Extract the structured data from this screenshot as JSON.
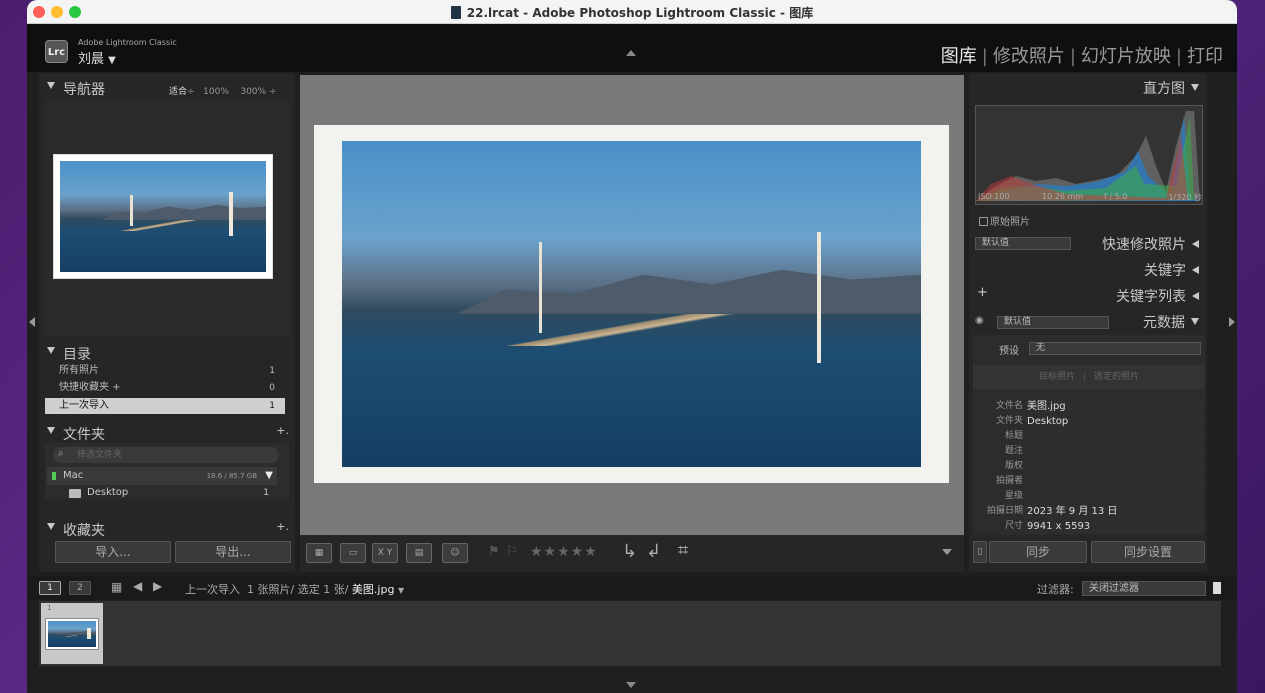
{
  "window": {
    "title": "22.lrcat - Adobe Photoshop Lightroom Classic - 图库"
  },
  "identity": {
    "app": "Adobe Lightroom Classic",
    "user": "刘晨",
    "dropdown": "▼",
    "logo": "Lrc"
  },
  "modules": {
    "library": "图库",
    "develop": "修改照片",
    "slideshow": "幻灯片放映",
    "print": "打印",
    "sep": "|"
  },
  "navigator": {
    "title": "导航器",
    "fit": "适合",
    "zoom1": "100%",
    "zoom2": "300%",
    "spinner": "÷"
  },
  "catalog": {
    "title": "目录",
    "items": [
      {
        "label": "所有照片",
        "count": "1"
      },
      {
        "label": "快捷收藏夹 +",
        "count": "0"
      },
      {
        "label": "上一次导入",
        "count": "1"
      }
    ]
  },
  "folders": {
    "title": "文件夹",
    "add": "+.",
    "search_placeholder": "筛选文件夹",
    "volume": "Mac",
    "volume_size": "18.6 / 85.7 GB",
    "folder": "Desktop",
    "folder_count": "1"
  },
  "collections": {
    "title": "收藏夹",
    "add": "+."
  },
  "left_buttons": {
    "import": "导入...",
    "export": "导出..."
  },
  "toolbar": {
    "xy": "X Y",
    "stars": "★★★★★"
  },
  "right": {
    "histogram_title": "直方图",
    "iso": "ISO 100",
    "focal": "10.26 mm",
    "aperture": "f / 5.0",
    "shutter": "1/320 秒",
    "original": "原始照片",
    "quick_preset": "默认值",
    "quick_develop": "快速修改照片",
    "keywording": "关键字",
    "keyword_list": "关键字列表",
    "keyword_plus": "+",
    "metadata_preset": "默认值",
    "metadata": "元数据",
    "preset_label": "预设",
    "preset_value": "无",
    "target_photo": "目标照片",
    "selected_photos": "选定的照片",
    "fields": [
      {
        "k": "文件名",
        "v": "美图.jpg"
      },
      {
        "k": "文件夹",
        "v": "Desktop"
      },
      {
        "k": "标题",
        "v": ""
      },
      {
        "k": "题注",
        "v": ""
      },
      {
        "k": "版权",
        "v": ""
      },
      {
        "k": "拍摄者",
        "v": ""
      },
      {
        "k": "星级",
        "v": ""
      },
      {
        "k": "拍摄日期",
        "v": "2023 年 9 月 13 日"
      },
      {
        "k": "尺寸",
        "v": "9941 x 5593"
      }
    ],
    "sync": "同步",
    "sync_settings": "同步设置"
  },
  "filmbar": {
    "view1": "1",
    "view2": "2",
    "source": "上一次导入",
    "info": "1 张照片/ 选定 1 张/",
    "filename": "美图.jpg",
    "filter_label": "过滤器:",
    "filter_value": "关闭过滤器"
  },
  "filmstrip": {
    "index": "1"
  },
  "colors": {
    "accent_active": "#e8e8e8",
    "panel": "#262626",
    "center_bg": "#7a7a7a"
  }
}
